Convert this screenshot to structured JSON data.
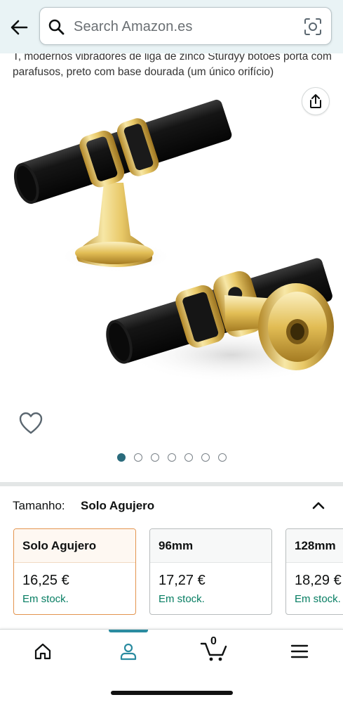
{
  "header": {
    "search_placeholder": "Search Amazon.es",
    "background": "#e9f3f5"
  },
  "product": {
    "title": "T, modernos vibradores de liga de zinco Sturdyy botões porta com parafusos, preto com base dourada (um único orifício)",
    "image_icon": "product-photo-t-knob",
    "image_count": 7,
    "active_image_index": 0
  },
  "size_selector": {
    "label": "Tamanho:",
    "selected": "Solo Agujero",
    "options": [
      {
        "name": "Solo Agujero",
        "price": "16,25 €",
        "stock": "Em stock.",
        "selected": true
      },
      {
        "name": "96mm",
        "price": "17,27 €",
        "stock": "Em stock.",
        "selected": false
      },
      {
        "name": "128mm",
        "price": "18,29 €",
        "stock": "Em stock.",
        "selected": false
      }
    ]
  },
  "bottom_nav": {
    "items": [
      {
        "icon": "home-icon"
      },
      {
        "icon": "account-icon",
        "active": true
      },
      {
        "icon": "cart-icon",
        "count": "0"
      },
      {
        "icon": "menu-icon"
      }
    ]
  },
  "colors": {
    "accent": "#2a8ba0",
    "in_stock": "#067d62",
    "selected_border": "#e3944e"
  }
}
